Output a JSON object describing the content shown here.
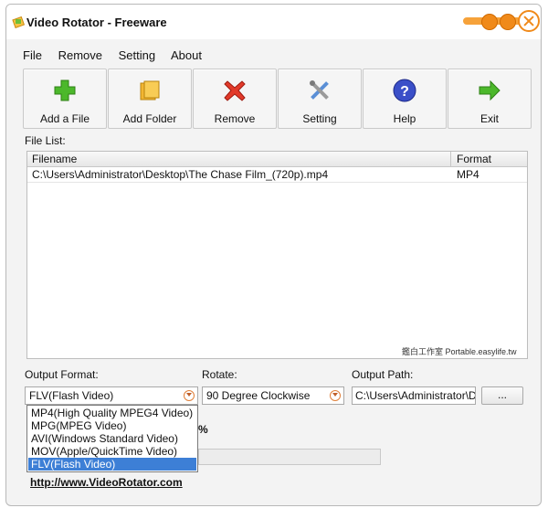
{
  "window": {
    "title": "Video Rotator - Freeware"
  },
  "menu": [
    "File",
    "Remove",
    "Setting",
    "About"
  ],
  "toolbar": [
    {
      "label": "Add a File",
      "icon": "plus-icon"
    },
    {
      "label": "Add Folder",
      "icon": "folder-icon"
    },
    {
      "label": "Remove",
      "icon": "cross-icon"
    },
    {
      "label": "Setting",
      "icon": "tools-icon"
    },
    {
      "label": "Help",
      "icon": "help-icon"
    },
    {
      "label": "Exit",
      "icon": "arrow-right-icon"
    }
  ],
  "file_list": {
    "label": "File List:",
    "columns": [
      "Filename",
      "Format"
    ],
    "rows": [
      {
        "filename": "C:\\Users\\Administrator\\Desktop\\The Chase Film_(720p).mp4",
        "format": "MP4"
      }
    ],
    "watermark": "鑑白工作室 Portable.easylife.tw"
  },
  "output_format": {
    "label": "Output Format:",
    "selected": "FLV(Flash Video)",
    "options": [
      "MP4(High Quality MPEG4 Video)",
      "MPG(MPEG Video)",
      "AVI(Windows Standard Video)",
      "MOV(Apple/QuickTime Video)",
      "FLV(Flash Video)"
    ]
  },
  "rotate": {
    "label": "Rotate:",
    "selected": "90 Degree Clockwise"
  },
  "output_path": {
    "label": "Output Path:",
    "value": "C:\\Users\\Administrator\\D",
    "browse_label": "..."
  },
  "progress": {
    "percent_text": "%"
  },
  "footer": {
    "link": "http://www.VideoRotator.com"
  },
  "colors": {
    "accent": "#f08a1a",
    "selection": "#3d7fd6"
  }
}
